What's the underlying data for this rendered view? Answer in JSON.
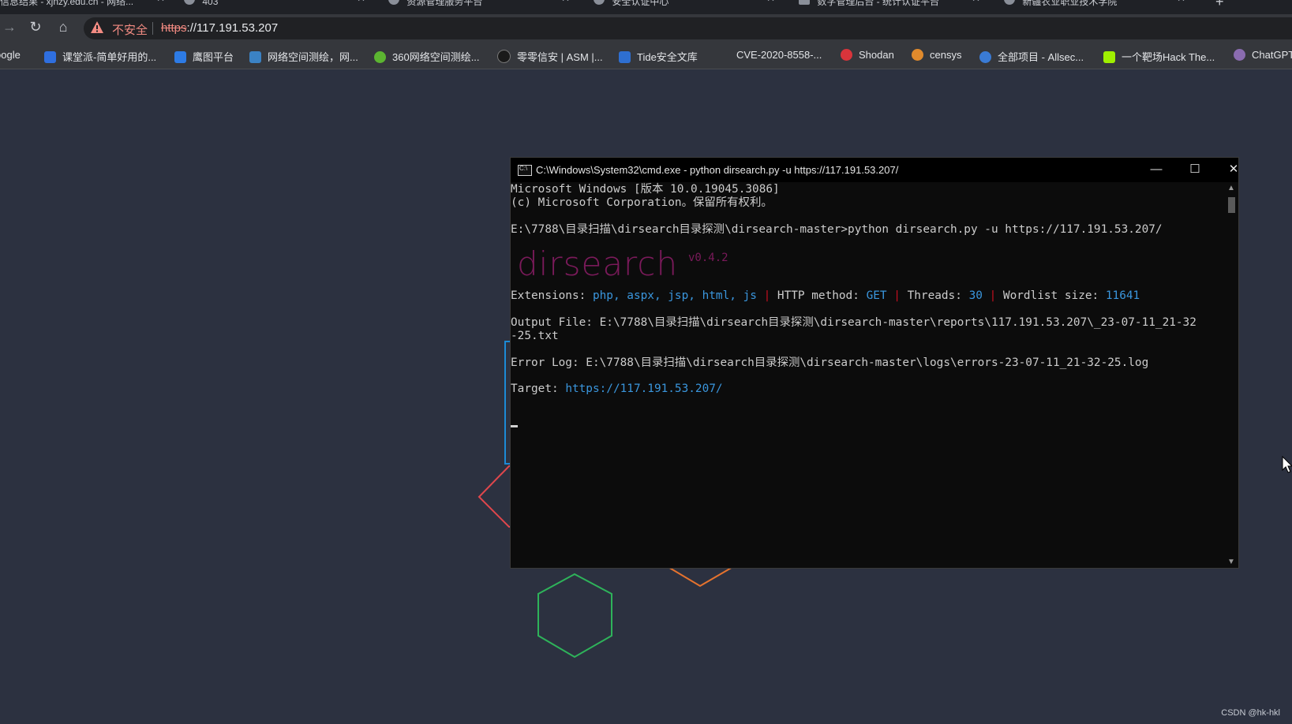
{
  "browser": {
    "tabs": [
      {
        "label": "信息结果 - xjnzy.edu.cn - 网络..."
      },
      {
        "label": "403"
      },
      {
        "label": "资源管理服务平台"
      },
      {
        "label": "安全认证中心"
      },
      {
        "label": "数字管理后台 - 统计认证平台"
      },
      {
        "label": "新疆农业职业技术学院"
      }
    ],
    "new_tab": "+",
    "nav": {
      "back": "→",
      "reload": "↻",
      "home": "⌂"
    },
    "address": {
      "security_label": "不安全",
      "url_scheme": "https",
      "url_rest": "://117.191.53.207"
    },
    "bookmarks": [
      {
        "label": "oogle",
        "color": "#4285f4"
      },
      {
        "label": "课堂派-简单好用的...",
        "color": "#2f6fe0"
      },
      {
        "label": "鹰图平台",
        "color": "#2d7be5"
      },
      {
        "label": "网络空间测绘，网...",
        "color": "#3b82c4"
      },
      {
        "label": "360网络空间测绘...",
        "color": "#5cb531"
      },
      {
        "label": "零零信安 | ASM |...",
        "color": "#1a1a1a"
      },
      {
        "label": "Tide安全文库",
        "color": "#2e6fd1"
      },
      {
        "label": "CVE-2020-8558-...",
        "color": ""
      },
      {
        "label": "Shodan",
        "color": "#d9343b"
      },
      {
        "label": "censys",
        "color": "#e08a2c"
      },
      {
        "label": "全部项目 - Allsec...",
        "color": "#3a7bd5"
      },
      {
        "label": "一个靶场Hack The...",
        "color": "#9fef00"
      },
      {
        "label": "ChatGPT",
        "color": "#8a6cb0"
      }
    ]
  },
  "cmd": {
    "title": "C:\\Windows\\System32\\cmd.exe - python  dirsearch.py -u https://117.191.53.207/",
    "controls": {
      "minimize": "—",
      "maximize": "☐",
      "close": "✕"
    },
    "lines": {
      "l1": "Microsoft Windows [版本 10.0.19045.3086]",
      "l2": "(c) Microsoft Corporation。保留所有权利。",
      "l3": "E:\\7788\\目录扫描\\dirsearch目录探测\\dirsearch-master>python dirsearch.py -u https://117.191.53.207/"
    },
    "logo": "dirsearch",
    "version": "v0.4.2",
    "config": {
      "ext_label": "Extensions: ",
      "ext_value": "php, aspx, jsp, html, js",
      "method_label": "HTTP method: ",
      "method_value": "GET",
      "threads_label": "Threads: ",
      "threads_value": "30",
      "wordlist_label": "Wordlist size: ",
      "wordlist_value": "11641",
      "separator": "|"
    },
    "output_file_1": "Output File: E:\\7788\\目录扫描\\dirsearch目录探测\\dirsearch-master\\reports\\117.191.53.207\\_23-07-11_21-32",
    "output_file_2": "-25.txt",
    "error_log": "Error Log: E:\\7788\\目录扫描\\dirsearch目录探测\\dirsearch-master\\logs\\errors-23-07-11_21-32-25.log",
    "target_label": "Target: ",
    "target_value": "https://117.191.53.207/"
  },
  "page": {
    "watermark": "CSDN @hk-hkl"
  }
}
